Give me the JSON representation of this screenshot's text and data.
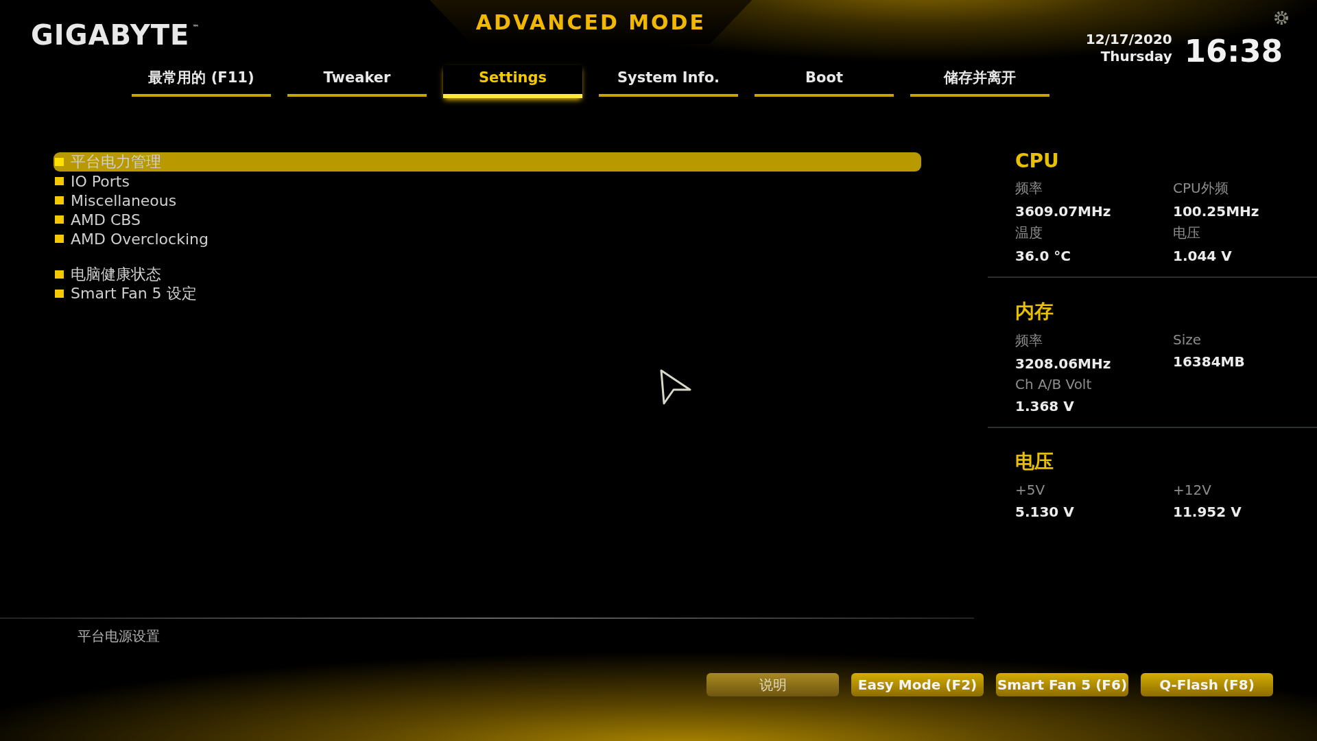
{
  "header": {
    "logo": "GIGABYTE",
    "logo_mark": "™",
    "title": "ADVANCED MODE",
    "date": "12/17/2020",
    "weekday": "Thursday",
    "time": "16:38"
  },
  "tabs": [
    {
      "label": "最常用的 (F11)",
      "selected": false
    },
    {
      "label": "Tweaker",
      "selected": false
    },
    {
      "label": "Settings",
      "selected": true
    },
    {
      "label": "System Info.",
      "selected": false
    },
    {
      "label": "Boot",
      "selected": false
    },
    {
      "label": "储存并离开",
      "selected": false
    }
  ],
  "menu": {
    "groups": [
      {
        "items": [
          {
            "label": "平台电力管理",
            "selected": true
          },
          {
            "label": "IO Ports",
            "selected": false
          },
          {
            "label": "Miscellaneous",
            "selected": false
          },
          {
            "label": "AMD CBS",
            "selected": false
          },
          {
            "label": "AMD Overclocking",
            "selected": false
          }
        ]
      },
      {
        "items": [
          {
            "label": "电脑健康状态",
            "selected": false
          },
          {
            "label": "Smart Fan 5 设定",
            "selected": false
          }
        ]
      }
    ]
  },
  "monitor": [
    {
      "title": "CPU",
      "readings": [
        {
          "label": "频率",
          "value": "3609.07MHz"
        },
        {
          "label": "CPU外频",
          "value": "100.25MHz"
        },
        {
          "label": "温度",
          "value": "36.0 °C"
        },
        {
          "label": "电压",
          "value": "1.044 V"
        }
      ]
    },
    {
      "title": "内存",
      "readings": [
        {
          "label": "频率",
          "value": "3208.06MHz"
        },
        {
          "label": "Size",
          "value": "16384MB"
        },
        {
          "label": "Ch A/B Volt",
          "value": "1.368 V"
        }
      ]
    },
    {
      "title": "电压",
      "readings": [
        {
          "label": "+5V",
          "value": "5.130 V"
        },
        {
          "label": "+12V",
          "value": "11.952 V"
        }
      ]
    }
  ],
  "help_text": "平台电源设置",
  "buttons": [
    {
      "label": "说明",
      "kind": "dim"
    },
    {
      "label": "Easy Mode (F2)",
      "kind": "normal"
    },
    {
      "label": "Smart Fan 5 (F6)",
      "kind": "normal"
    },
    {
      "label": "Q-Flash (F8)",
      "kind": "normal"
    }
  ]
}
